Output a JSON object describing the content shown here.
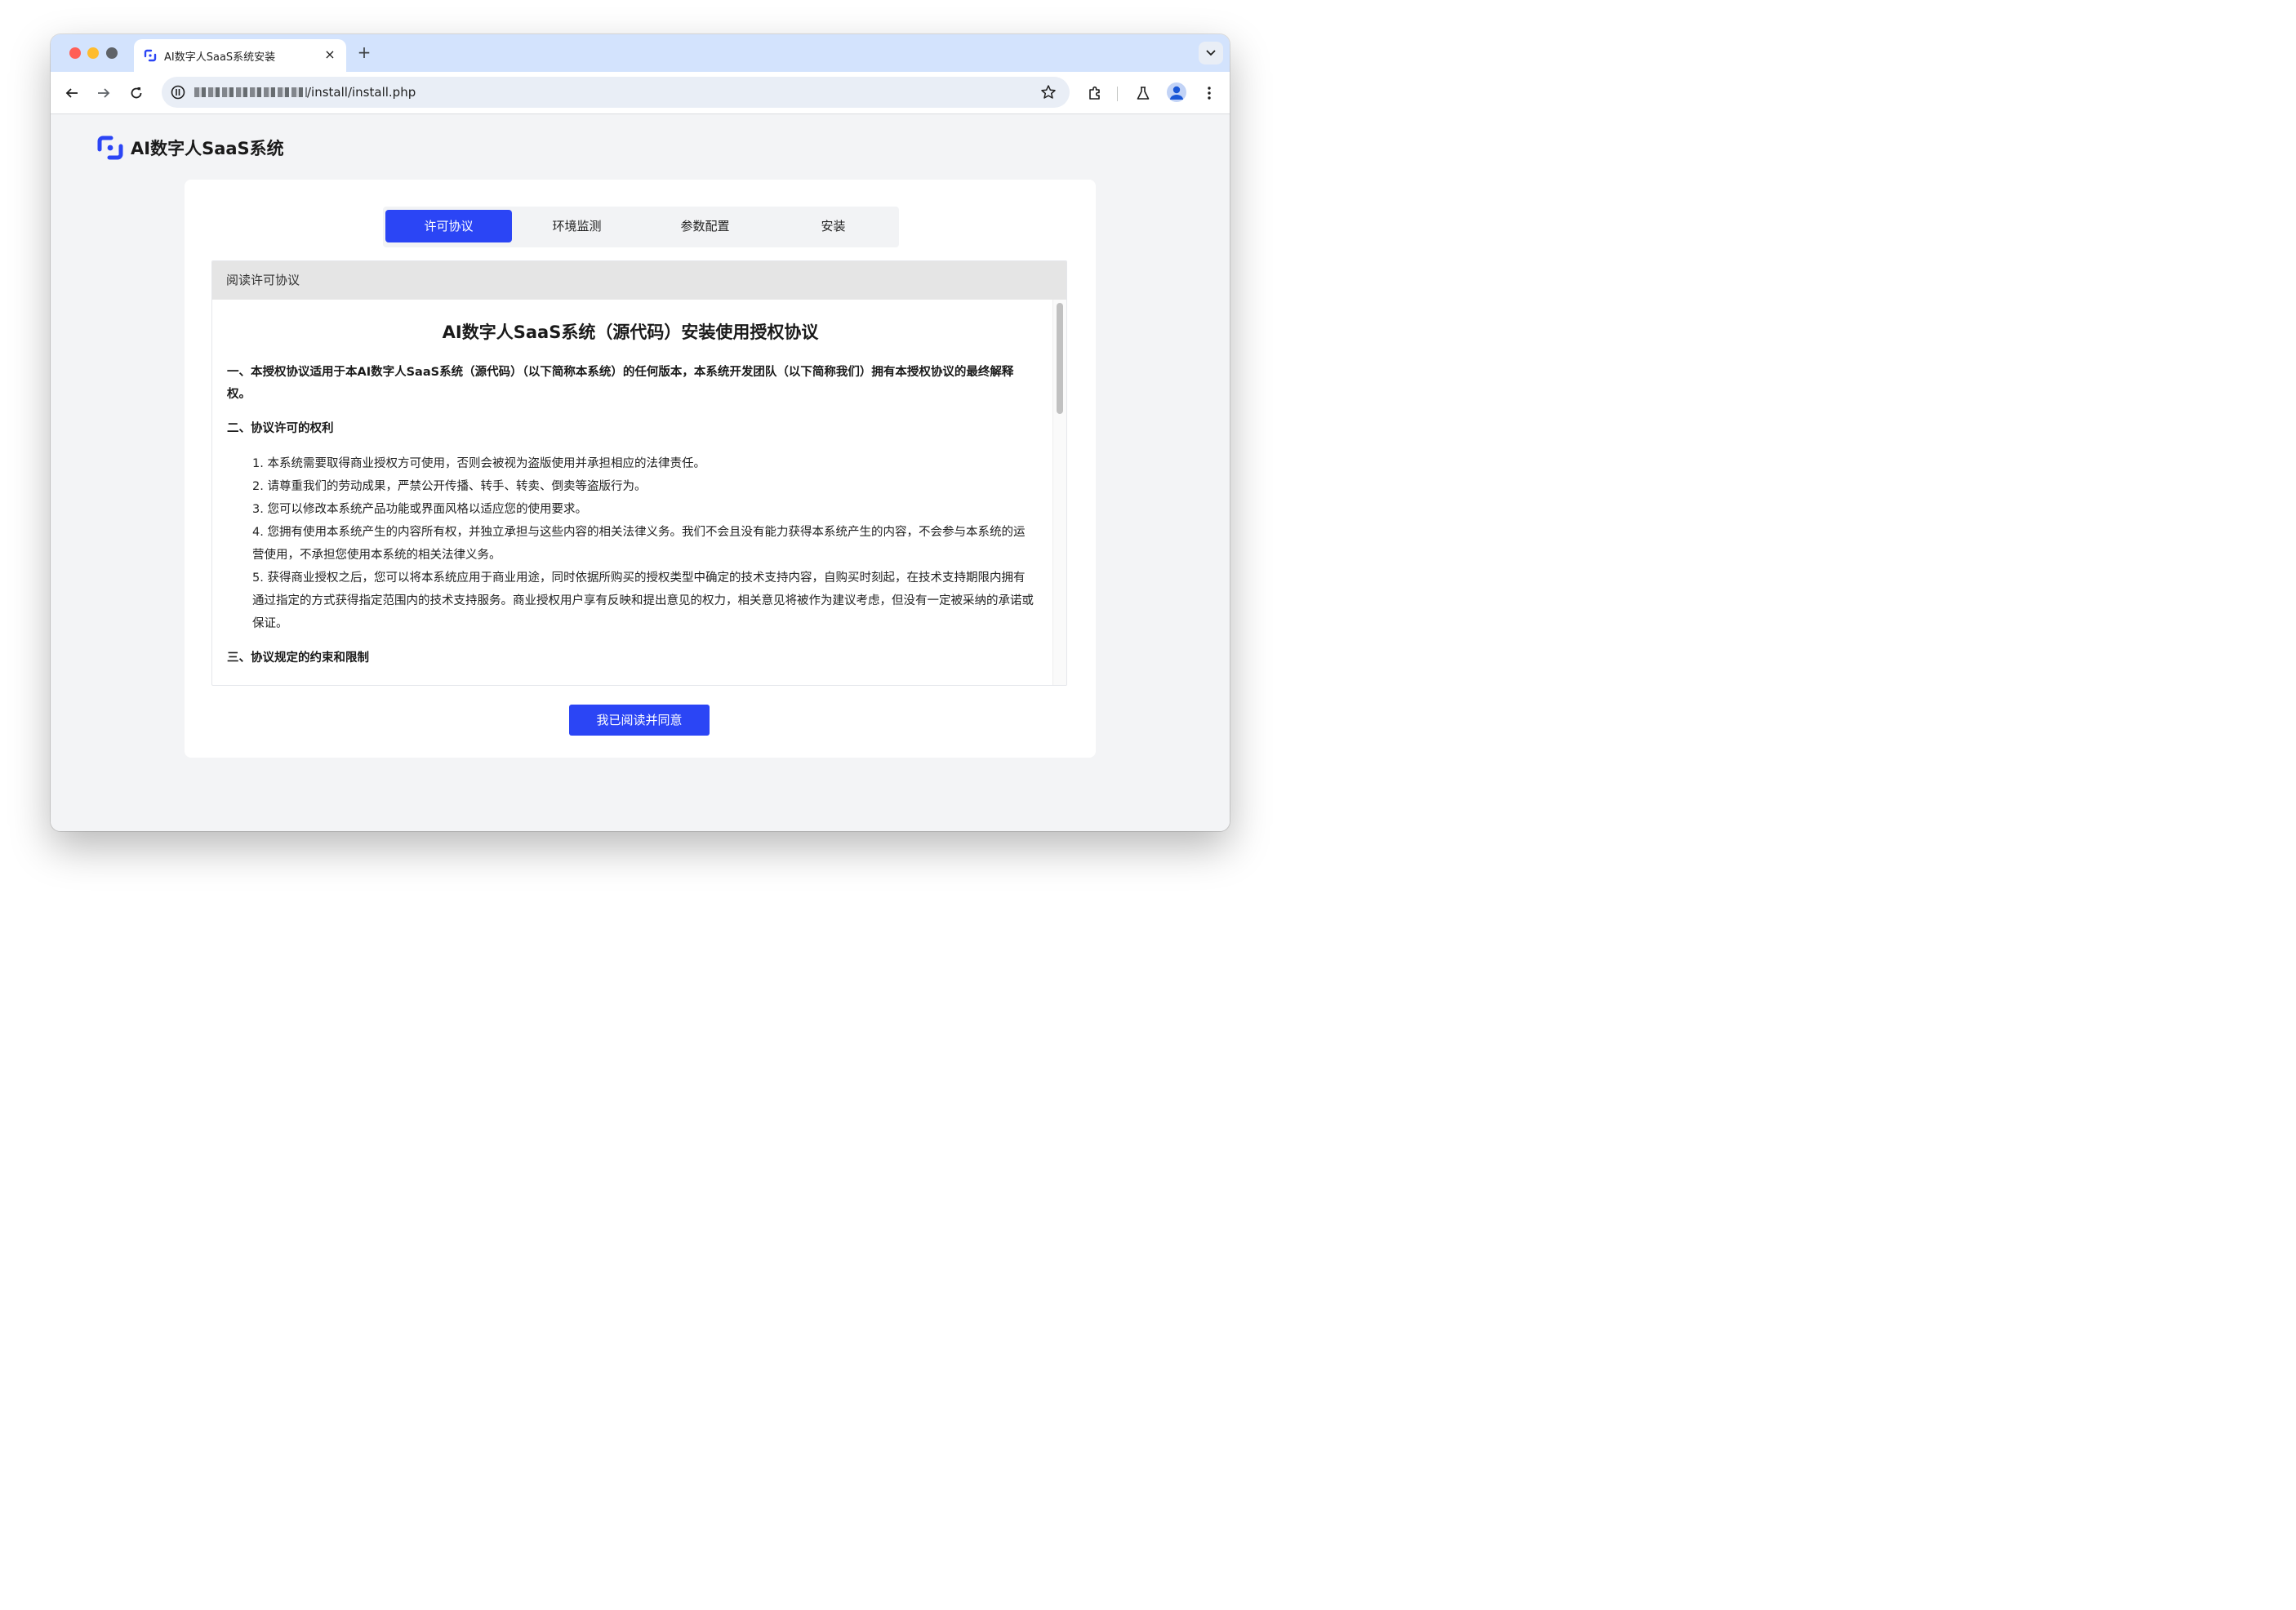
{
  "browser": {
    "tab_title": "AI数字人SaaS系统安装",
    "tab_close": "×",
    "new_tab": "+",
    "url_path": "/install/install.php"
  },
  "brand": {
    "name": "AI数字人SaaS系统",
    "color": "#2b45f5"
  },
  "steps": [
    {
      "label": "许可协议",
      "active": true
    },
    {
      "label": "环境监测",
      "active": false
    },
    {
      "label": "参数配置",
      "active": false
    },
    {
      "label": "安装",
      "active": false
    }
  ],
  "panel": {
    "header": "阅读许可协议",
    "doc_title": "AI数字人SaaS系统（源代码）安装使用授权协议",
    "section1": "一、本授权协议适用于本AI数字人SaaS系统（源代码）（以下简称本系统）的任何版本，本系统开发团队（以下简称我们）拥有本授权协议的最终解释权。",
    "section2": "二、协议许可的权利",
    "items": [
      "1. 本系统需要取得商业授权方可使用，否则会被视为盗版使用并承担相应的法律责任。",
      "2. 请尊重我们的劳动成果，严禁公开传播、转手、转卖、倒卖等盗版行为。",
      "3. 您可以修改本系统产品功能或界面风格以适应您的使用要求。",
      "4. 您拥有使用本系统产生的内容所有权，并独立承担与这些内容的相关法律义务。我们不会且没有能力获得本系统产生的内容，不会参与本系统的运营使用，不承担您使用本系统的相关法律义务。",
      "5. 获得商业授权之后，您可以将本系统应用于商业用途，同时依据所购买的授权类型中确定的技术支持内容，自购买时刻起，在技术支持期限内拥有通过指定的方式获得指定范围内的技术支持服务。商业授权用户享有反映和提出意见的权力，相关意见将被作为建议考虑，但没有一定被采纳的承诺或保证。"
    ],
    "section3": "三、协议规定的约束和限制"
  },
  "agree_button": "我已阅读并同意"
}
